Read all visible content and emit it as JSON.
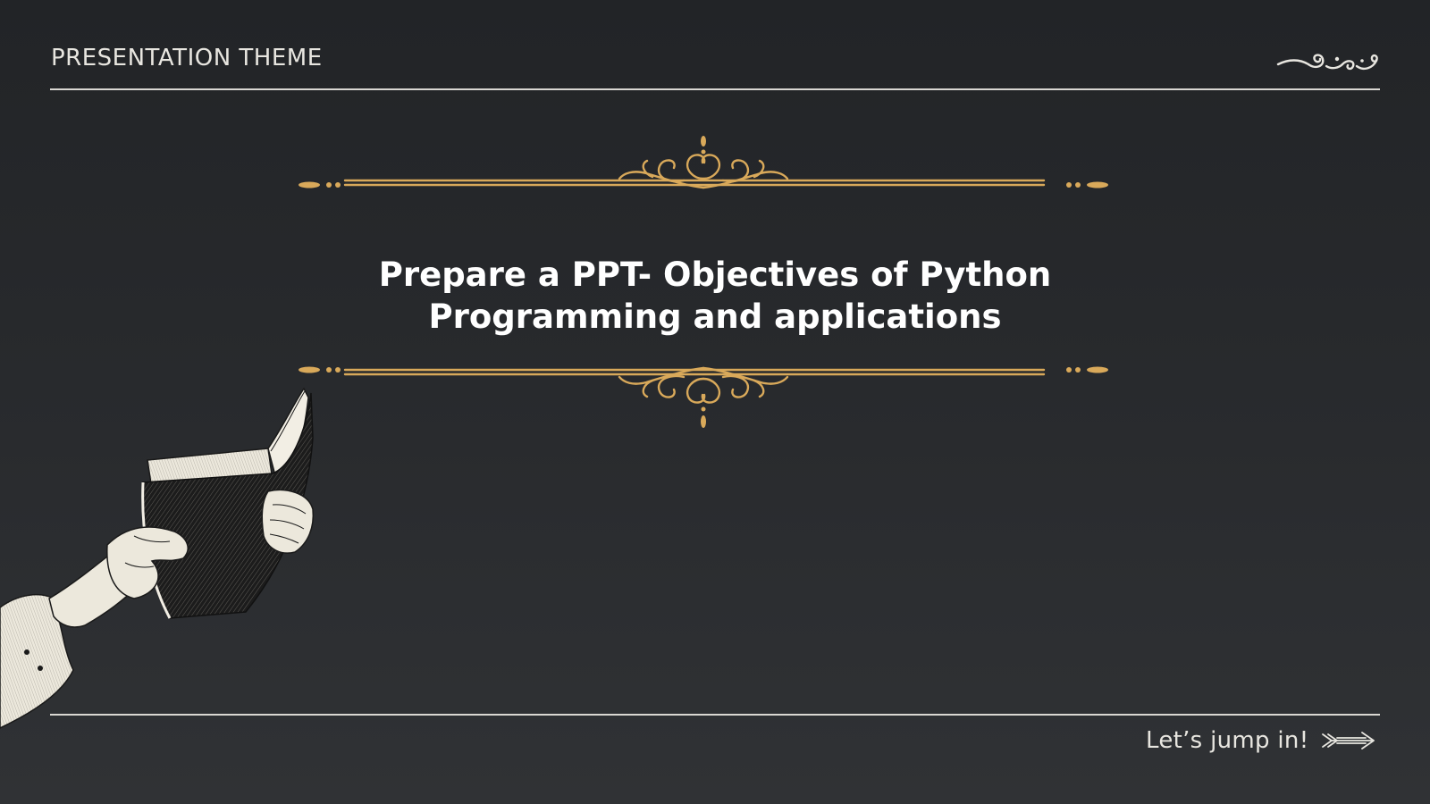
{
  "header": {
    "theme_label": "PRESENTATION THEME",
    "corner_icon": "swirl-flourish-icon"
  },
  "main": {
    "title": "Prepare a PPT- Objectives of Python Programming and applications",
    "ornament_top_icon": "gold-scroll-ornament-icon",
    "ornament_bottom_icon": "gold-scroll-ornament-icon",
    "illustration_icon": "hand-holding-book-icon"
  },
  "footer": {
    "cta_label": "Let’s jump in!",
    "cta_icon": "arrow-right-icon"
  },
  "colors": {
    "background": "#26282b",
    "gold": "#d9a95a",
    "text": "#e8e6e0",
    "title": "#ffffff"
  }
}
